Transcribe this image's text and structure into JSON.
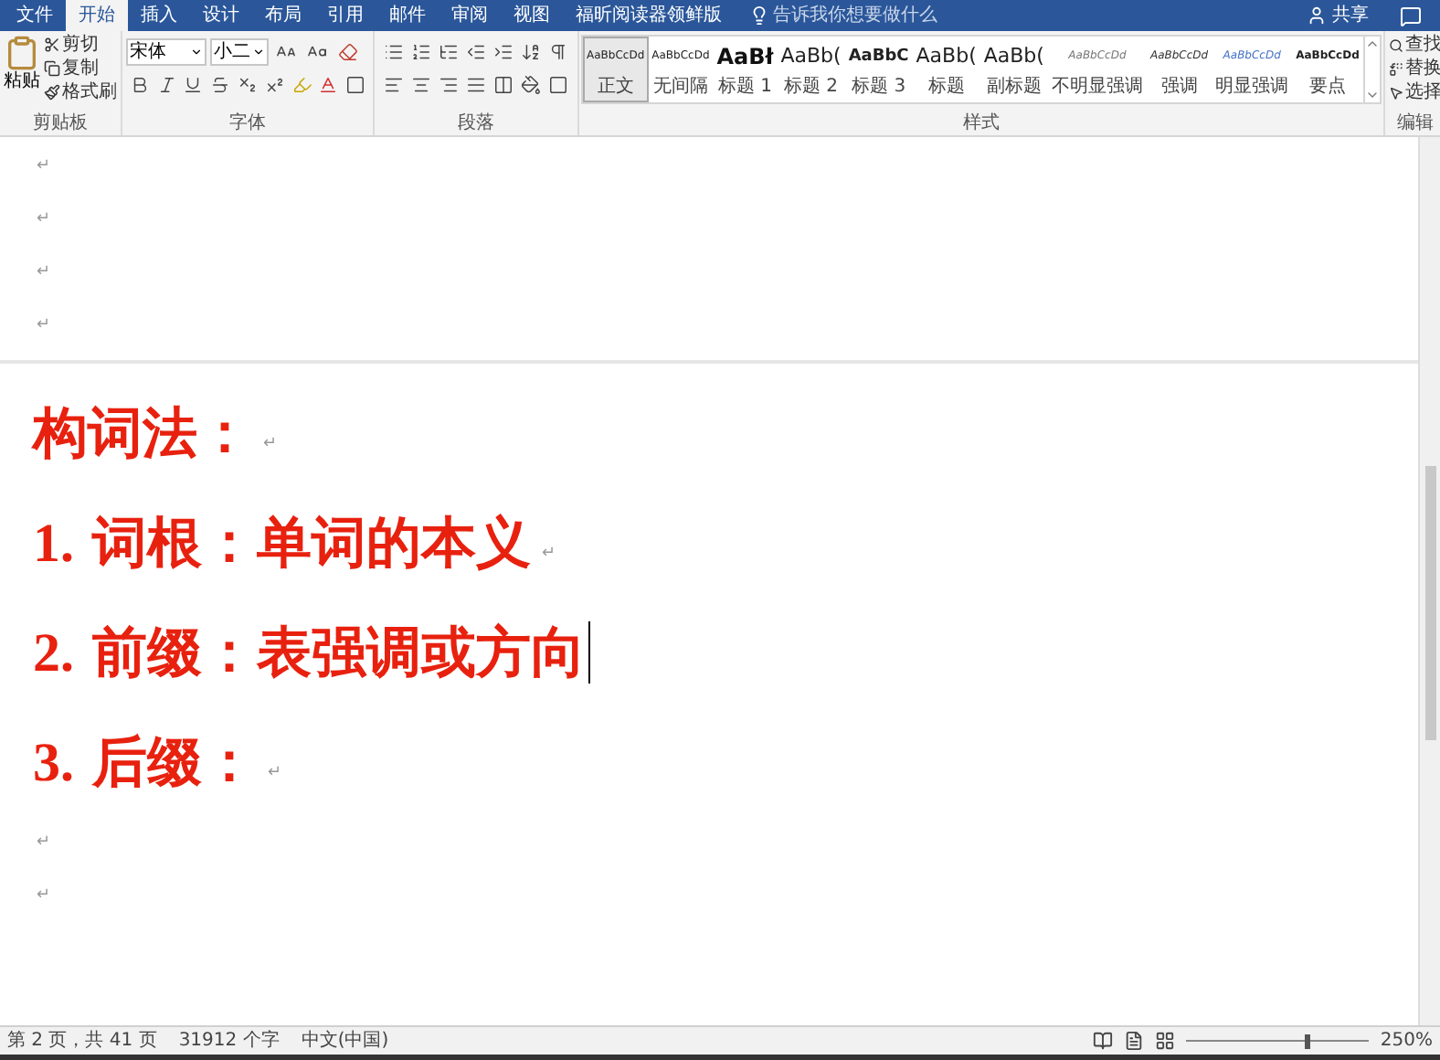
{
  "tabs": [
    {
      "label": "文件",
      "selected": false
    },
    {
      "label": "开始",
      "selected": true
    },
    {
      "label": "插入",
      "selected": false
    },
    {
      "label": "设计",
      "selected": false
    },
    {
      "label": "布局",
      "selected": false
    },
    {
      "label": "引用",
      "selected": false
    },
    {
      "label": "邮件",
      "selected": false
    },
    {
      "label": "审阅",
      "selected": false
    },
    {
      "label": "视图",
      "selected": false
    },
    {
      "label": "福昕阅读器领鲜版",
      "selected": false
    }
  ],
  "tell_me": "告诉我你想要做什么",
  "share": "共享",
  "clipboard": {
    "paste": "粘贴",
    "cut": "剪切",
    "copy": "复制",
    "format_painter": "格式刷",
    "label": "剪贴板"
  },
  "font": {
    "name": "宋体",
    "size": "小二",
    "label": "字体"
  },
  "paragraph": {
    "label": "段落"
  },
  "styles": {
    "label": "样式",
    "items": [
      {
        "sample": "AaBbCcDd",
        "name": "正文",
        "selected": true,
        "kind": "body"
      },
      {
        "sample": "AaBbCcDd",
        "name": "无间隔",
        "selected": false,
        "kind": "body"
      },
      {
        "sample": "AaBł",
        "name": "标题 1",
        "selected": false,
        "kind": "heading1"
      },
      {
        "sample": "AaBb(",
        "name": "标题 2",
        "selected": false,
        "kind": "heading2"
      },
      {
        "sample": "AaBbC",
        "name": "标题 3",
        "selected": false,
        "kind": "heading3"
      },
      {
        "sample": "AaBb(",
        "name": "标题",
        "selected": false,
        "kind": "title"
      },
      {
        "sample": "AaBb(",
        "name": "副标题",
        "selected": false,
        "kind": "title"
      },
      {
        "sample": "AaBbCcDd",
        "name": "不明显强调",
        "selected": false,
        "kind": "subtle"
      },
      {
        "sample": "AaBbCcDd",
        "name": "强调",
        "selected": false,
        "kind": "emphasis"
      },
      {
        "sample": "AaBbCcDd",
        "name": "明显强调",
        "selected": false,
        "kind": "intense"
      },
      {
        "sample": "AaBbCcDd",
        "name": "要点",
        "selected": false,
        "kind": "strong"
      }
    ]
  },
  "editing": {
    "label": "编辑",
    "find": "查找",
    "replace": "替换",
    "select": "选择"
  },
  "document": {
    "page_1": [
      {
        "kind": "empty",
        "mark": "↵"
      },
      {
        "kind": "empty",
        "mark": "↵"
      },
      {
        "kind": "empty",
        "mark": "↵"
      },
      {
        "kind": "empty",
        "mark": "↵"
      }
    ],
    "page_2": [
      {
        "kind": "line",
        "text": "构词法：",
        "mark": "↵",
        "cursor": false
      },
      {
        "kind": "line",
        "number": "1.",
        "text": "词根：单词的本义",
        "mark": "↵",
        "cursor": false
      },
      {
        "kind": "line",
        "number": "2.",
        "text": "前缀：表强调或方向",
        "cursor": true
      },
      {
        "kind": "line",
        "number": "3.",
        "text": "后缀：",
        "mark": "↵",
        "cursor": false
      },
      {
        "kind": "empty",
        "mark": "↵"
      },
      {
        "kind": "empty",
        "mark": "↵"
      }
    ]
  },
  "status_bar": {
    "page": "第 2 页，共 41 页",
    "words": "31912 个字",
    "language": "中文(中国)",
    "zoom": "250%",
    "zoom_slider": {
      "level": 0.66
    }
  }
}
